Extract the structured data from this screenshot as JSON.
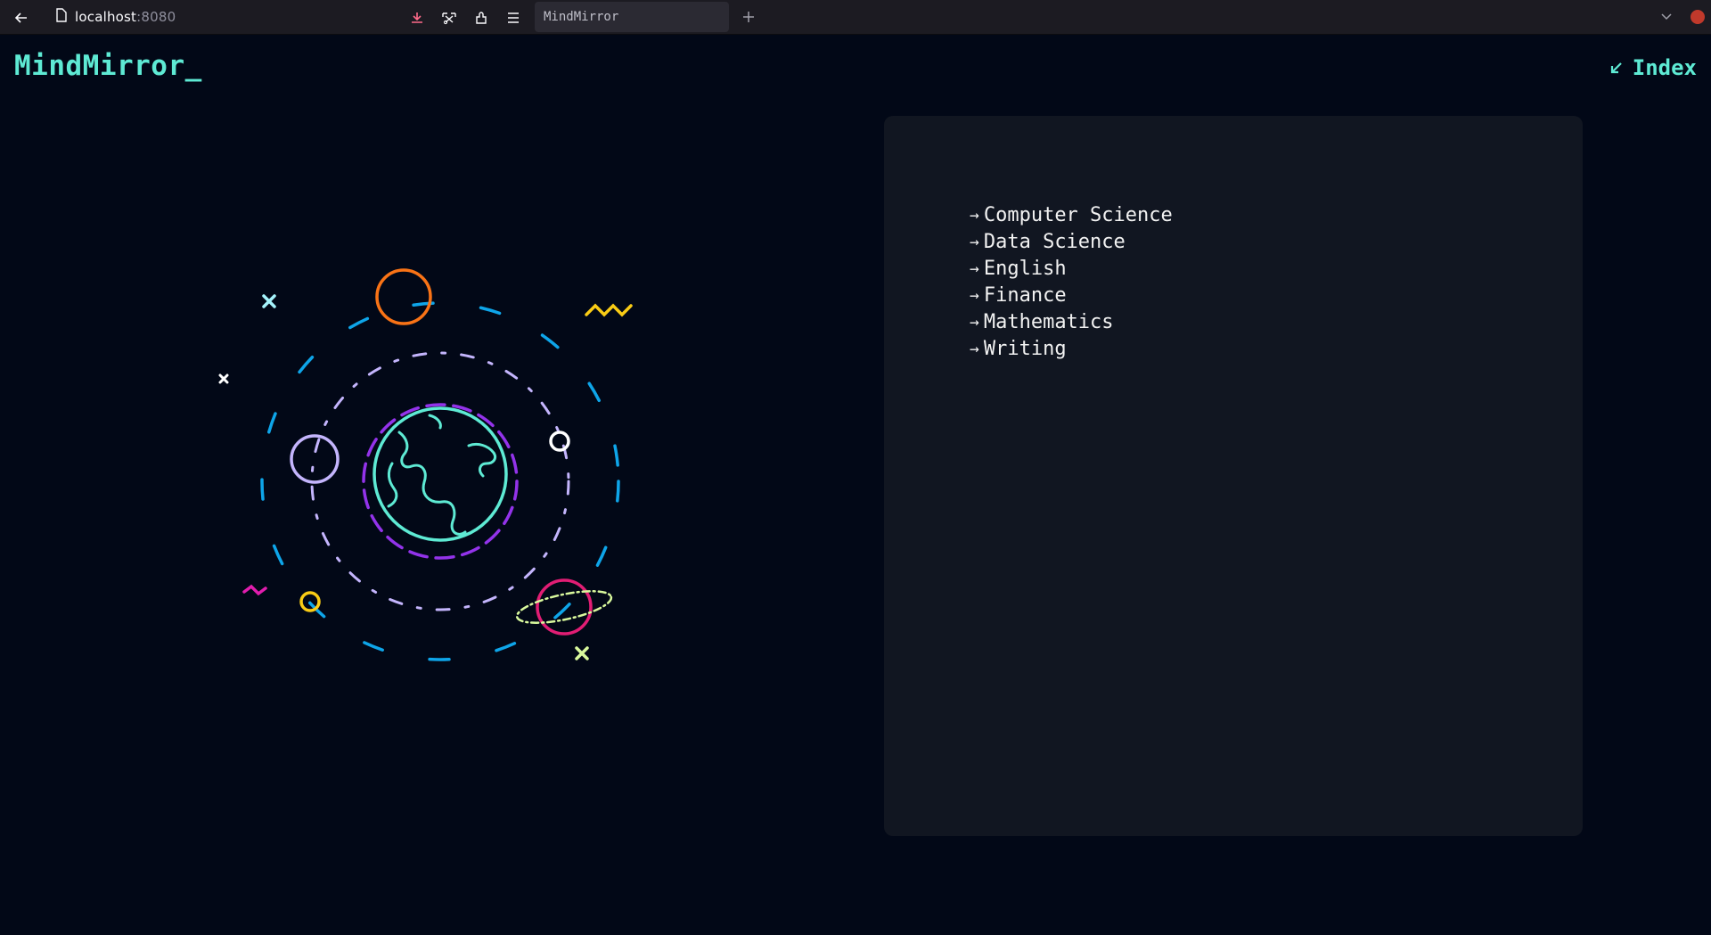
{
  "browser": {
    "url_host": "localhost",
    "url_port": ":8080",
    "tab_title": "MindMirror",
    "icons": [
      "back-arrow-icon",
      "page-icon",
      "download-icon",
      "screenshot-icon",
      "extensions-icon",
      "menu-icon",
      "new-tab-icon",
      "list-tabs-icon",
      "close-window-icon"
    ]
  },
  "header": {
    "logo": "MindMirror_",
    "index_label": "Index",
    "index_icon": "arrow-down-left-icon"
  },
  "colors": {
    "accent": "#5eead4",
    "background": "#020817",
    "panel": "#111621"
  },
  "topics": [
    {
      "label": "Computer Science"
    },
    {
      "label": "Data Science"
    },
    {
      "label": "English"
    },
    {
      "label": "Finance"
    },
    {
      "label": "Mathematics"
    },
    {
      "label": "Writing"
    }
  ]
}
